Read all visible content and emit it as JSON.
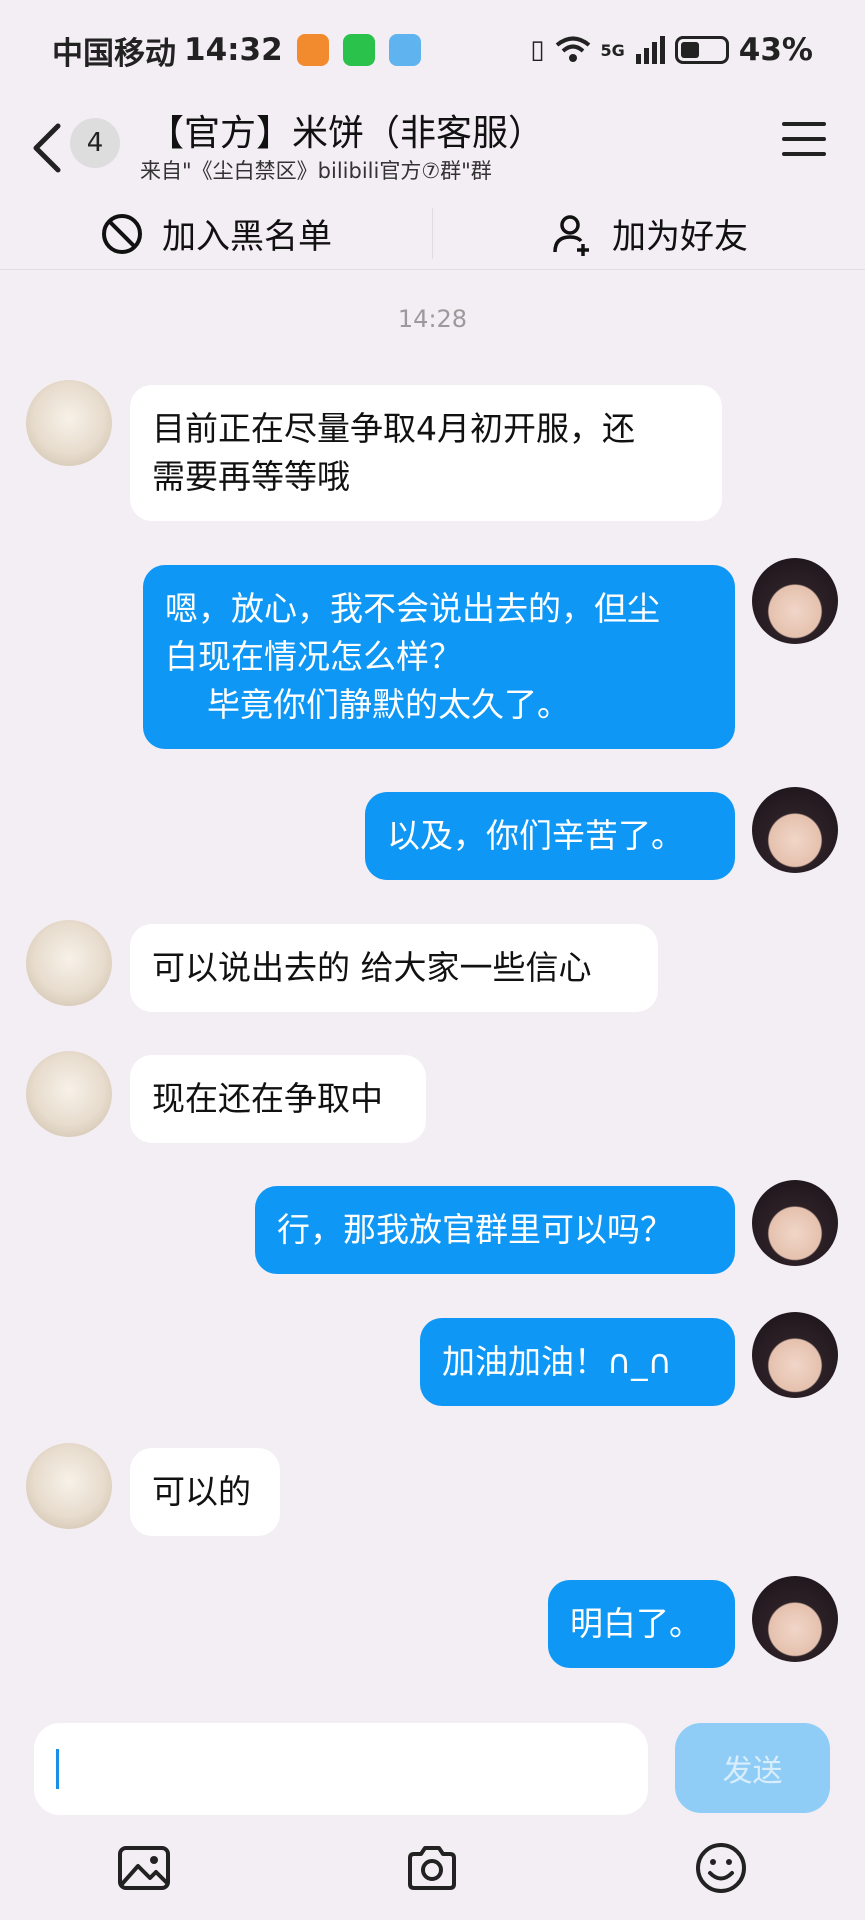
{
  "status_bar": {
    "carrier": "中国移动",
    "time": "14:32",
    "network": "5G",
    "battery": "43%",
    "battery_level": 0.43,
    "apps": [
      "taobao-icon",
      "wechat-icon",
      "reader-icon"
    ]
  },
  "header": {
    "unread_count": "4",
    "title": "【官方】米饼（非客服）",
    "subtitle": "来自\"《尘白禁区》bilibili官方⑦群\"群"
  },
  "actions": {
    "blacklist": "加入黑名单",
    "add_friend": "加为好友"
  },
  "chat": {
    "timestamp": "14:28",
    "messages": [
      {
        "side": "in",
        "text": "目前正在尽量争取4月初开服，还\n需要再等等哦"
      },
      {
        "side": "out",
        "text": "嗯，放心，我不会说出去的，但尘\n白现在情况怎么样？\n    毕竟你们静默的太久了。"
      },
      {
        "side": "out",
        "text": "以及，你们辛苦了。"
      },
      {
        "side": "in",
        "text": "可以说出去的 给大家一些信心"
      },
      {
        "side": "in",
        "text": "现在还在争取中"
      },
      {
        "side": "out",
        "text": "行，那我放官群里可以吗？"
      },
      {
        "side": "out",
        "text": "加油加油！∩_∩"
      },
      {
        "side": "in",
        "text": "可以的"
      },
      {
        "side": "out",
        "text": "明白了。"
      }
    ]
  },
  "input": {
    "value": "",
    "send_label": "发送"
  },
  "colors": {
    "outgoing_bubble": "#0e97f5",
    "incoming_bubble": "#ffffff",
    "background": "#f3eef3",
    "send_button": "#8fcdf6"
  },
  "toolbar": {
    "icons": [
      "image-icon",
      "camera-icon",
      "emoji-icon"
    ]
  }
}
